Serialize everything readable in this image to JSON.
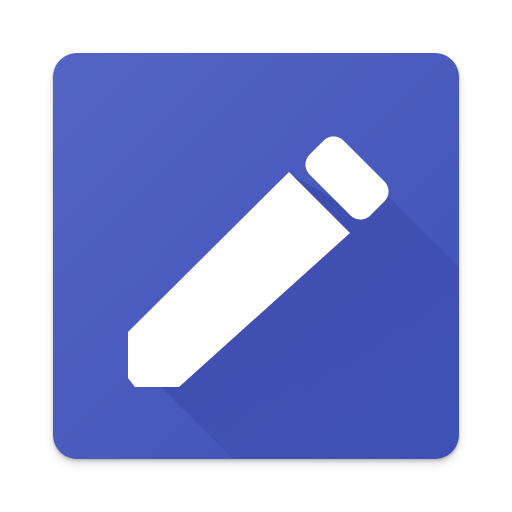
{
  "icon": {
    "name": "pencil-icon",
    "colors": {
      "background": "#3F51B5",
      "background_highlight": "#5465C4",
      "long_shadow": "#1A237E",
      "pencil": "#FFFFFF"
    }
  }
}
